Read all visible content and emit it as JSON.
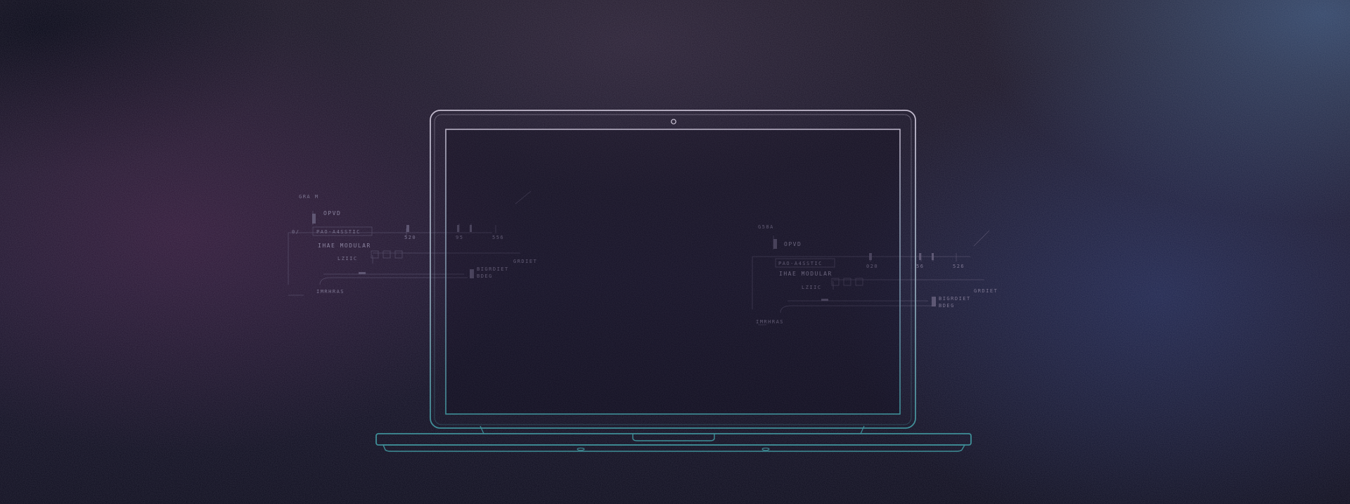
{
  "scene": {
    "colors": {
      "laptop_frame": "#c4bccf",
      "laptop_teal": "#3f8f98",
      "screen_divider": "#3a6f7d",
      "hud_text": "#7c7590",
      "hud_lines": "#5f5874"
    },
    "icons": [
      "laptop-outline-icon",
      "webcam-icon",
      "status-led-icon"
    ]
  },
  "hud_left": {
    "top_tag": "GRA M",
    "line1": "OPVD",
    "field": "PAO-A4SSTIC",
    "mark_a": "0/",
    "num1": "520",
    "num2": "95",
    "num3": "556",
    "line2": "IHAE MODULAR",
    "line3": "LZIIC",
    "code1": "GRDIET",
    "code2": "BIGRDIET",
    "sub": "BDEG",
    "foot": "IMRHRAS"
  },
  "hud_right": {
    "top_tag": "G58A",
    "line1": "OPVD",
    "field": "PAO-A4SSTIC",
    "num1": "020",
    "num2": "56",
    "num3": "526",
    "line2": "IHAE MODULAR",
    "line3": "LZIIC",
    "code1": "GRDIET",
    "code2": "BIGRDIET",
    "sub": "BDEG",
    "foot": "IMRHRAS"
  }
}
